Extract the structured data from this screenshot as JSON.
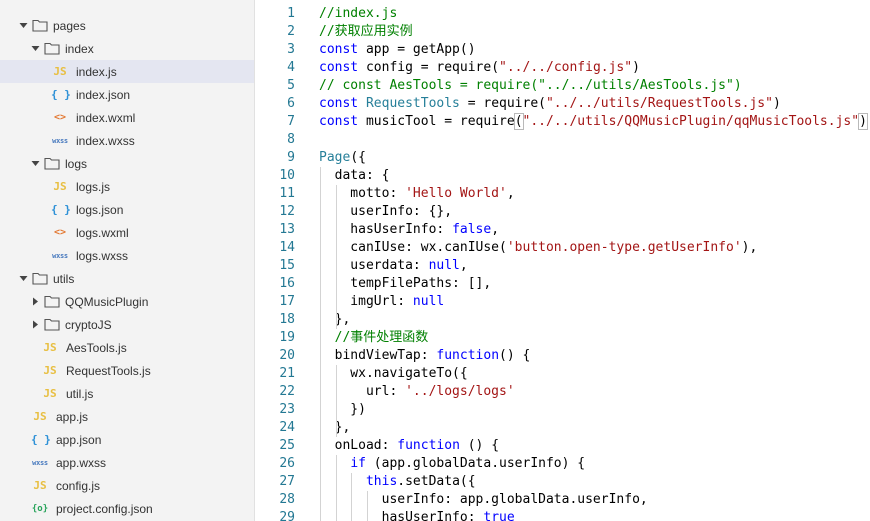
{
  "explorer": {
    "items": [
      {
        "label": "pages",
        "kind": "folder",
        "open": true,
        "chevron": "down"
      },
      {
        "label": "index",
        "kind": "folder",
        "open": true,
        "chevron": "down"
      },
      {
        "label": "index.js",
        "kind": "js",
        "badge": "JS"
      },
      {
        "label": "index.json",
        "kind": "json",
        "badge": "{ }"
      },
      {
        "label": "index.wxml",
        "kind": "wxml",
        "badge": "<>"
      },
      {
        "label": "index.wxss",
        "kind": "wxss",
        "badge": "wxss"
      },
      {
        "label": "logs",
        "kind": "folder",
        "open": true,
        "chevron": "down"
      },
      {
        "label": "logs.js",
        "kind": "js",
        "badge": "JS"
      },
      {
        "label": "logs.json",
        "kind": "json",
        "badge": "{ }"
      },
      {
        "label": "logs.wxml",
        "kind": "wxml",
        "badge": "<>"
      },
      {
        "label": "logs.wxss",
        "kind": "wxss",
        "badge": "wxss"
      },
      {
        "label": "utils",
        "kind": "folder",
        "open": true,
        "chevron": "down"
      },
      {
        "label": "QQMusicPlugin",
        "kind": "folder",
        "open": false,
        "chevron": "right"
      },
      {
        "label": "cryptoJS",
        "kind": "folder",
        "open": false,
        "chevron": "right"
      },
      {
        "label": "AesTools.js",
        "kind": "js",
        "badge": "JS"
      },
      {
        "label": "RequestTools.js",
        "kind": "js",
        "badge": "JS"
      },
      {
        "label": "util.js",
        "kind": "js",
        "badge": "JS"
      },
      {
        "label": "app.js",
        "kind": "js",
        "badge": "JS"
      },
      {
        "label": "app.json",
        "kind": "json",
        "badge": "{ }"
      },
      {
        "label": "app.wxss",
        "kind": "wxss",
        "badge": "wxss"
      },
      {
        "label": "config.js",
        "kind": "js",
        "badge": "JS"
      },
      {
        "label": "project.config.json",
        "kind": "cfg",
        "badge": "{o}"
      }
    ],
    "selected_index": 2
  },
  "editor": {
    "colors": {
      "keyword": "#0000ff",
      "string": "#a31515",
      "comment": "#008000",
      "type": "#267f99",
      "line_number": "#237893"
    },
    "lines": [
      {
        "n": "1",
        "tokens": [
          [
            "cm",
            "//index.js"
          ]
        ]
      },
      {
        "n": "2",
        "tokens": [
          [
            "cm",
            "//获取应用实例"
          ]
        ]
      },
      {
        "n": "3",
        "tokens": [
          [
            "kw",
            "const"
          ],
          [
            "pl",
            " app = getApp()"
          ]
        ]
      },
      {
        "n": "4",
        "tokens": [
          [
            "kw",
            "const"
          ],
          [
            "pl",
            " config = require("
          ],
          [
            "str",
            "\"../../config.js\""
          ],
          [
            "pl",
            ")"
          ]
        ]
      },
      {
        "n": "5",
        "tokens": [
          [
            "cm",
            "// const AesTools = require(\"../../utils/AesTools.js\")"
          ]
        ]
      },
      {
        "n": "6",
        "tokens": [
          [
            "kw",
            "const"
          ],
          [
            "pl",
            " "
          ],
          [
            "ty",
            "RequestTools"
          ],
          [
            "pl",
            " = require("
          ],
          [
            "str",
            "\"../../utils/RequestTools.js\""
          ],
          [
            "pl",
            ")"
          ]
        ]
      },
      {
        "n": "7",
        "tokens": [
          [
            "kw",
            "const"
          ],
          [
            "pl",
            " musicTool = require"
          ],
          [
            "box",
            "("
          ],
          [
            "str",
            "\"../../utils/QQMusicPlugin/qqMusicTools.js\""
          ],
          [
            "box",
            ")"
          ]
        ]
      },
      {
        "n": "8",
        "tokens": []
      },
      {
        "n": "9",
        "tokens": [
          [
            "ty",
            "Page"
          ],
          [
            "pl",
            "({"
          ]
        ]
      },
      {
        "n": "10",
        "tokens": [
          [
            "pl",
            "  data: {"
          ]
        ]
      },
      {
        "n": "11",
        "tokens": [
          [
            "pl",
            "    motto: "
          ],
          [
            "str",
            "'Hello World'"
          ],
          [
            "pl",
            ","
          ]
        ]
      },
      {
        "n": "12",
        "tokens": [
          [
            "pl",
            "    userInfo: {},"
          ]
        ]
      },
      {
        "n": "13",
        "tokens": [
          [
            "pl",
            "    hasUserInfo: "
          ],
          [
            "kw",
            "false"
          ],
          [
            "pl",
            ","
          ]
        ]
      },
      {
        "n": "14",
        "tokens": [
          [
            "pl",
            "    canIUse: wx.canIUse("
          ],
          [
            "str",
            "'button.open-type.getUserInfo'"
          ],
          [
            "pl",
            "),"
          ]
        ]
      },
      {
        "n": "15",
        "tokens": [
          [
            "pl",
            "    userdata: "
          ],
          [
            "kw",
            "null"
          ],
          [
            "pl",
            ","
          ]
        ]
      },
      {
        "n": "16",
        "tokens": [
          [
            "pl",
            "    tempFilePaths: [],"
          ]
        ]
      },
      {
        "n": "17",
        "tokens": [
          [
            "pl",
            "    imgUrl: "
          ],
          [
            "kw",
            "null"
          ]
        ]
      },
      {
        "n": "18",
        "tokens": [
          [
            "pl",
            "  },"
          ]
        ]
      },
      {
        "n": "19",
        "tokens": [
          [
            "pl",
            "  "
          ],
          [
            "cm",
            "//事件处理函数"
          ]
        ]
      },
      {
        "n": "20",
        "tokens": [
          [
            "pl",
            "  bindViewTap: "
          ],
          [
            "kw",
            "function"
          ],
          [
            "pl",
            "() {"
          ]
        ]
      },
      {
        "n": "21",
        "tokens": [
          [
            "pl",
            "    wx.navigateTo({"
          ]
        ]
      },
      {
        "n": "22",
        "tokens": [
          [
            "pl",
            "      url: "
          ],
          [
            "str",
            "'../logs/logs'"
          ]
        ]
      },
      {
        "n": "23",
        "tokens": [
          [
            "pl",
            "    })"
          ]
        ]
      },
      {
        "n": "24",
        "tokens": [
          [
            "pl",
            "  },"
          ]
        ]
      },
      {
        "n": "25",
        "tokens": [
          [
            "pl",
            "  onLoad: "
          ],
          [
            "kw",
            "function"
          ],
          [
            "pl",
            " () {"
          ]
        ]
      },
      {
        "n": "26",
        "tokens": [
          [
            "pl",
            "    "
          ],
          [
            "kw",
            "if"
          ],
          [
            "pl",
            " (app.globalData.userInfo) {"
          ]
        ]
      },
      {
        "n": "27",
        "tokens": [
          [
            "pl",
            "      "
          ],
          [
            "kw",
            "this"
          ],
          [
            "pl",
            ".setData({"
          ]
        ]
      },
      {
        "n": "28",
        "tokens": [
          [
            "pl",
            "        userInfo: app.globalData.userInfo,"
          ]
        ]
      },
      {
        "n": "29",
        "tokens": [
          [
            "pl",
            "        hasUserInfo: "
          ],
          [
            "kw",
            "true"
          ]
        ]
      }
    ]
  }
}
